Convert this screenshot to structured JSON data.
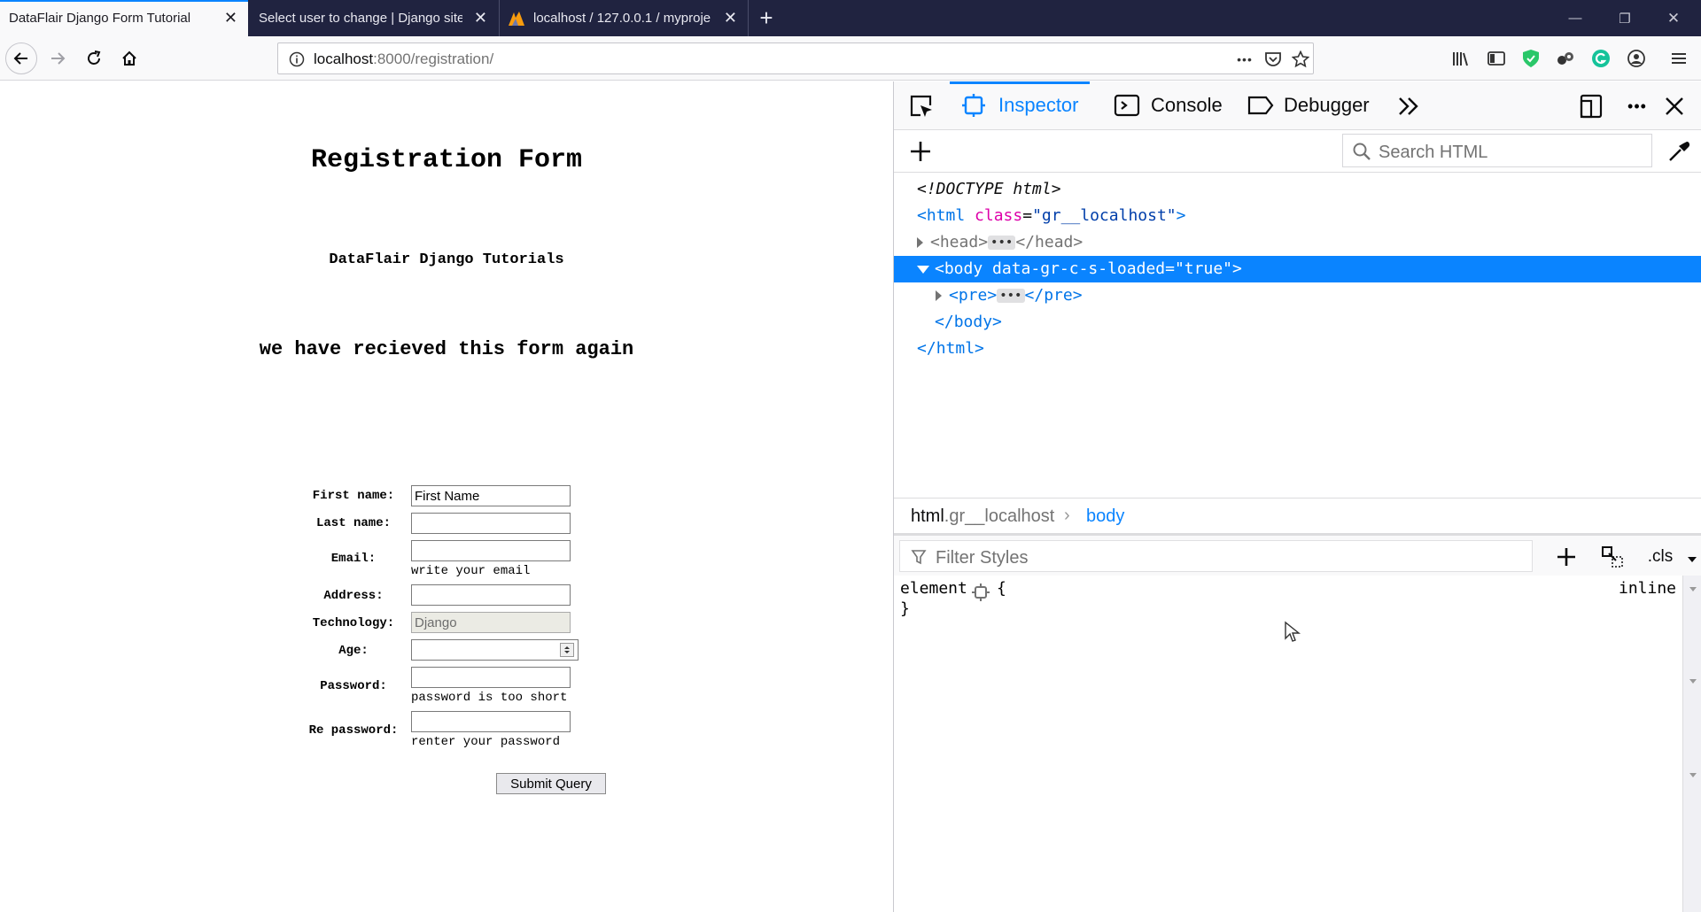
{
  "browser": {
    "tabs": [
      {
        "title": "DataFlair Django Form Tutorial",
        "active": true
      },
      {
        "title": "Select user to change | Django site",
        "active": false
      },
      {
        "title": "localhost / 127.0.0.1 / myproje",
        "active": false
      }
    ],
    "close_glyph": "✕",
    "new_tab_glyph": "+",
    "window_controls": {
      "minimize": "—",
      "restore": "❐",
      "close": "✕"
    },
    "url_host": "localhost",
    "url_rest": ":8000/registration/",
    "page_actions": "•••"
  },
  "page": {
    "title": "Registration Form",
    "subtitle": "DataFlair Django Tutorials",
    "message": "we have recieved this form again",
    "fields": [
      {
        "label": "First name:",
        "value": "First Name",
        "help": ""
      },
      {
        "label": "Last name:",
        "value": "",
        "help": ""
      },
      {
        "label": "Email:",
        "value": "",
        "help": "write your email"
      },
      {
        "label": "Address:",
        "value": "",
        "help": ""
      },
      {
        "label": "Technology:",
        "value": "Django",
        "help": ""
      },
      {
        "label": "Age:",
        "value": "",
        "help": ""
      },
      {
        "label": "Password:",
        "value": "",
        "help": "password is too short"
      },
      {
        "label": "Re password:",
        "value": "",
        "help": "renter your password"
      }
    ],
    "submit_label": "Submit Query"
  },
  "devtools": {
    "tabs": {
      "inspector": "Inspector",
      "console": "Console",
      "debugger": "Debugger"
    },
    "search_placeholder": "Search HTML",
    "markup": {
      "doctype": "<!DOCTYPE html>",
      "html_open_tag": "html",
      "html_class_attr": "class",
      "html_class_val": "\"gr__localhost\"",
      "head_tag": "head",
      "body_tag": "body",
      "body_attr": "data-gr-c-s-loaded",
      "body_attr_val": "\"true\"",
      "pre_tag": "pre",
      "ellipsis": "•••"
    },
    "breadcrumb": {
      "html": "html",
      "html_class": ".gr__localhost",
      "body": "body",
      "separator": "›"
    },
    "filter_placeholder": "Filter Styles",
    "cls_label": ".cls",
    "rule_selector": "element",
    "rule_open": "{",
    "rule_close": "}",
    "rule_source": "inline"
  },
  "colors": {
    "accent": "#0a84ff",
    "tabbar": "#202340",
    "tag": "#0074e8",
    "attr": "#dd00a9"
  }
}
